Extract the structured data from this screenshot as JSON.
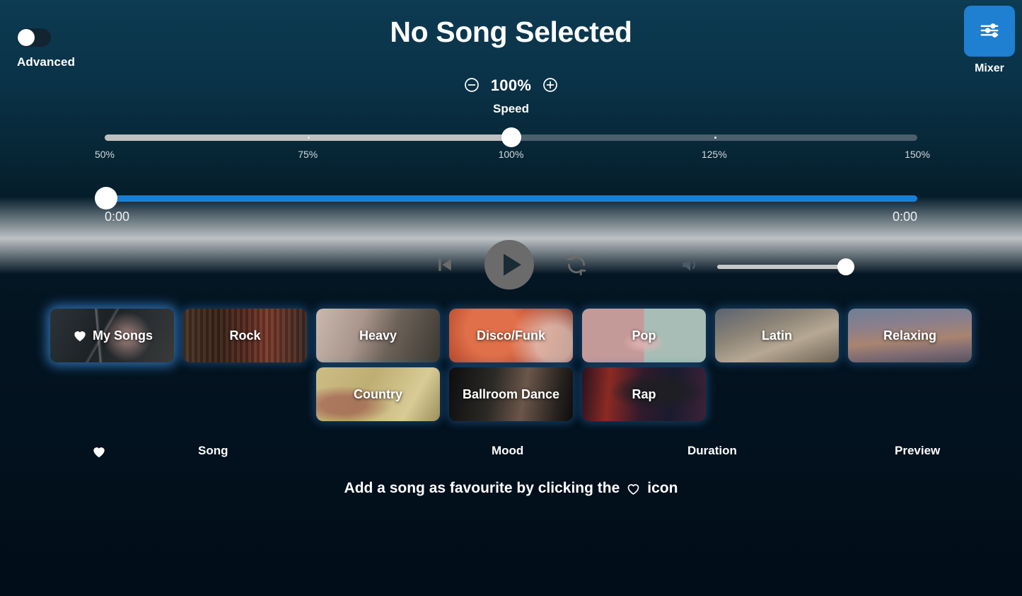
{
  "header": {
    "toggle": {
      "label": "Advanced",
      "state": "off"
    },
    "title": "No Song Selected",
    "mixer": {
      "label": "Mixer",
      "icon": "sliders-icon",
      "color": "#1f7fd0"
    }
  },
  "speed": {
    "decrease_icon": "minus-circle-icon",
    "increase_icon": "plus-circle-icon",
    "value": "100%",
    "label": "Speed",
    "slider": {
      "min_label": "50%",
      "ticks": [
        "50%",
        "75%",
        "100%",
        "125%",
        "150%"
      ],
      "max_label": "150%",
      "position_percent": 50
    }
  },
  "progress": {
    "current_time": "0:00",
    "total_time": "0:00",
    "position_percent": 0,
    "fill_color": "#1a7fd4"
  },
  "transport": {
    "previous_icon": "skip-previous-icon",
    "play_icon": "play-icon",
    "loop_icon": "repeat-icon",
    "volume_icon": "volume-icon",
    "volume_percent": 100
  },
  "genres": {
    "row1": [
      {
        "label": "My Songs",
        "art": "art-mysongs",
        "selected": true,
        "heart": true
      },
      {
        "label": "Rock",
        "art": "art-rock",
        "selected": false,
        "heart": false
      },
      {
        "label": "Heavy",
        "art": "art-heavy",
        "selected": false,
        "heart": false
      },
      {
        "label": "Disco/Funk",
        "art": "art-disco",
        "selected": false,
        "heart": false
      },
      {
        "label": "Pop",
        "art": "art-pop",
        "selected": false,
        "heart": false
      },
      {
        "label": "Latin",
        "art": "art-latin",
        "selected": false,
        "heart": false
      },
      {
        "label": "Relaxing",
        "art": "art-relaxing",
        "selected": false,
        "heart": false
      }
    ],
    "row2": [
      {
        "label": "Country",
        "art": "art-country",
        "selected": false,
        "heart": false
      },
      {
        "label": "Ballroom Dance",
        "art": "art-ballroom",
        "selected": false,
        "heart": false
      },
      {
        "label": "Rap",
        "art": "art-rap",
        "selected": false,
        "heart": false
      }
    ]
  },
  "table": {
    "columns": {
      "favourite_icon": "heart-filled-icon",
      "song": "Song",
      "mood": "Mood",
      "duration": "Duration",
      "preview": "Preview"
    },
    "rows": [],
    "empty_message_before": "Add a song as favourite by clicking the",
    "empty_message_icon": "heart-outline-icon",
    "empty_message_after": "icon"
  }
}
